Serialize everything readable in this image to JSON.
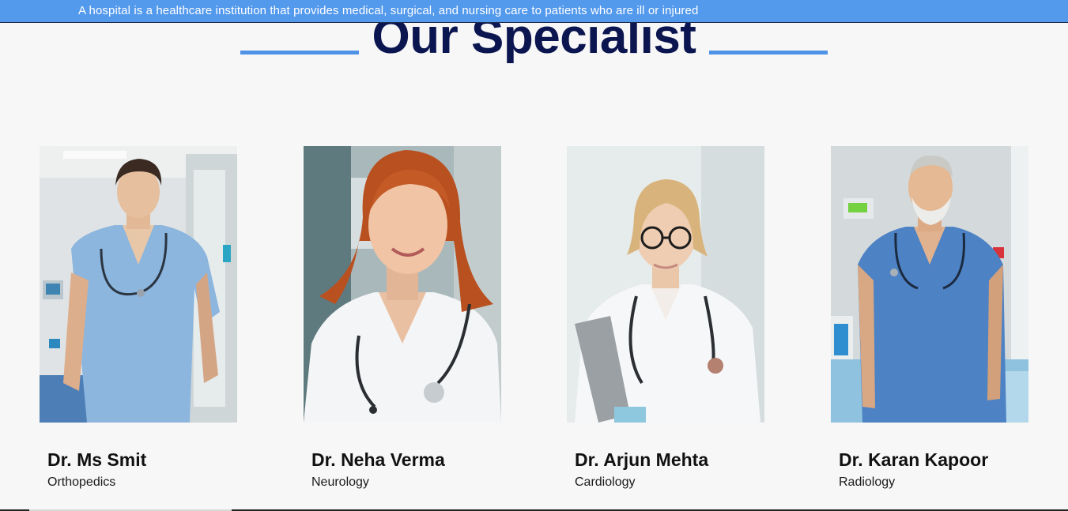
{
  "marquee": {
    "text": "A hospital is a healthcare institution that provides medical, surgical, and nursing care to patients who are ill or injured"
  },
  "section": {
    "title": "Our Specialist"
  },
  "doctors": [
    {
      "name": "Dr. Ms Smit",
      "specialty": "Orthopedics"
    },
    {
      "name": "Dr. Neha Verma",
      "specialty": "Neurology"
    },
    {
      "name": "Dr. Arjun Mehta",
      "specialty": "Cardiology"
    },
    {
      "name": "Dr. Karan Kapoor",
      "specialty": "Radiology"
    }
  ],
  "colors": {
    "marquee_bg": "#5399ec",
    "heading": "#0b1550",
    "accent_line": "#4f93e6",
    "page_bg": "#f7f7f7"
  }
}
